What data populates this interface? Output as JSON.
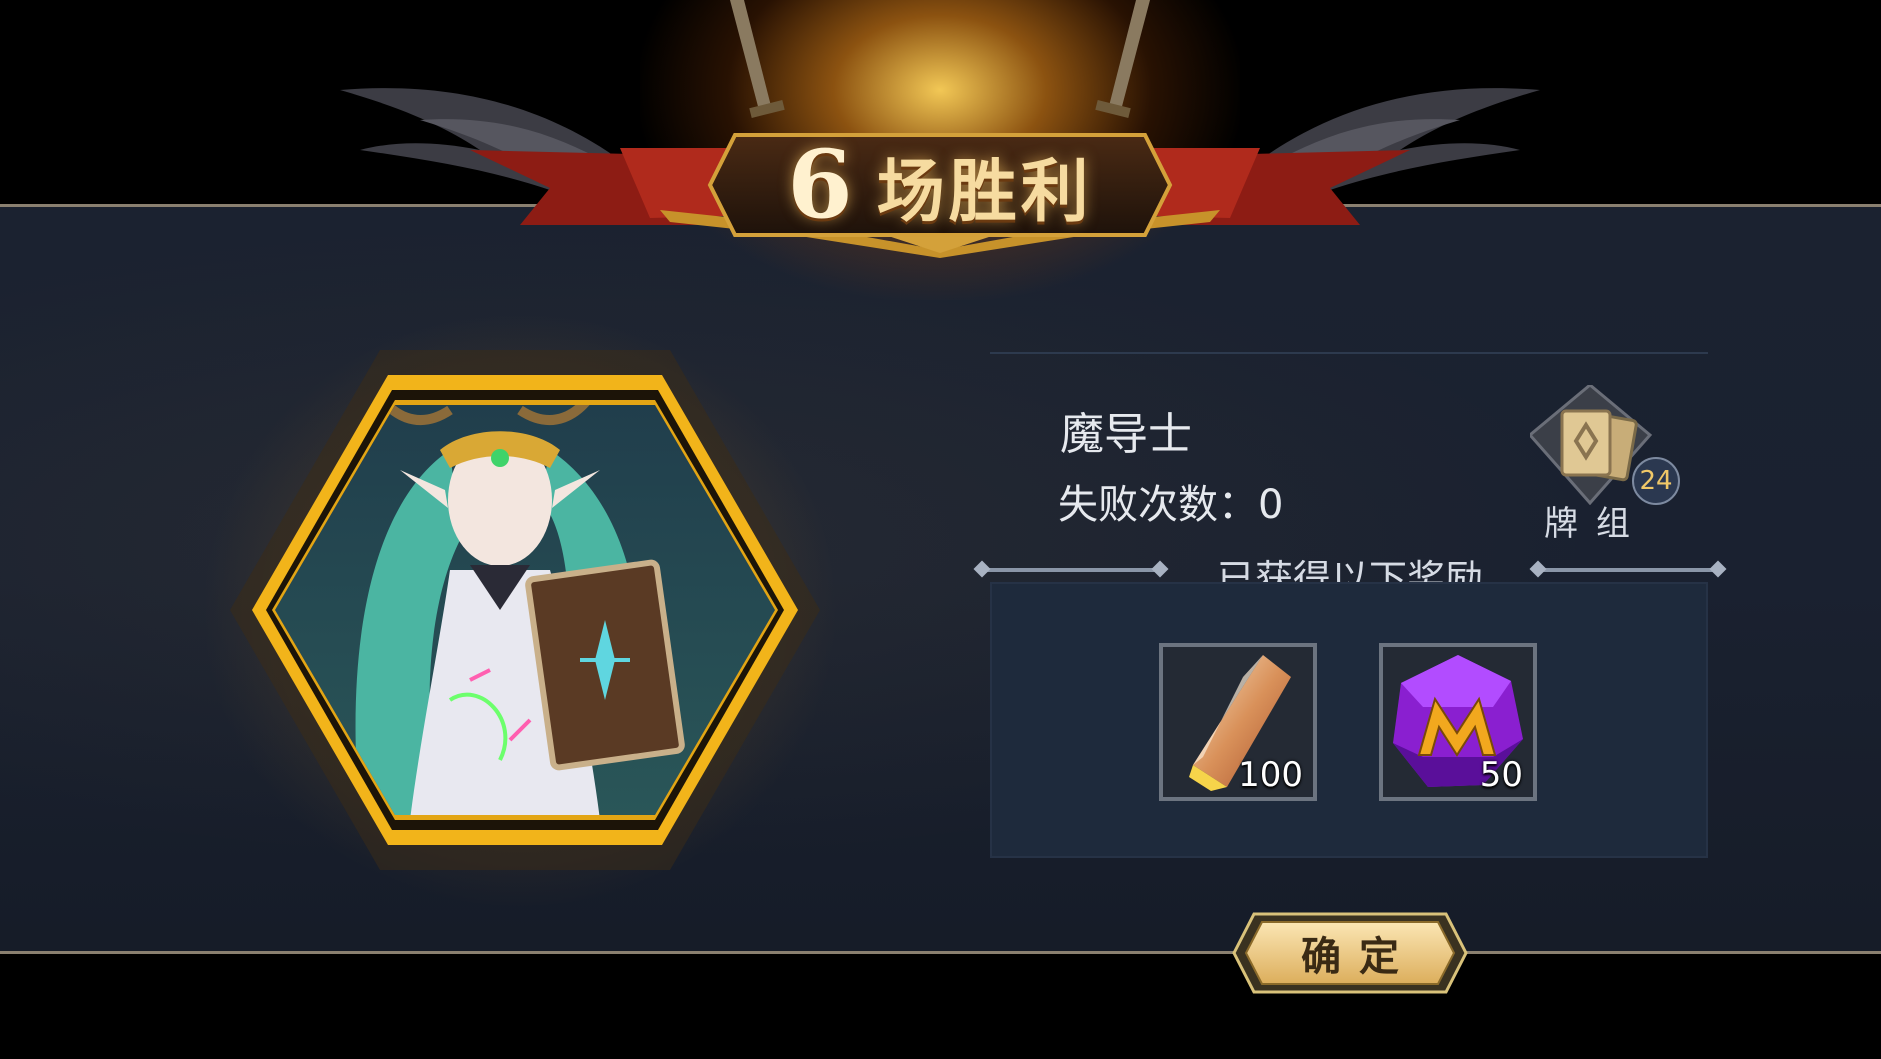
{
  "header": {
    "win_count": "6",
    "win_label": "场胜利"
  },
  "hero": {
    "portrait_icon": "mage-portrait-icon",
    "class_name": "魔导士",
    "defeats_label": "失败次数：",
    "defeats_value": "0"
  },
  "deck": {
    "icon": "card-deck-icon",
    "count": "24",
    "label": "牌组"
  },
  "rewards": {
    "title": "已获得以下奖励",
    "items": [
      {
        "icon": "amber-crystal-icon",
        "quantity": "100"
      },
      {
        "icon": "purple-m-gem-icon",
        "quantity": "50"
      }
    ]
  },
  "confirm": {
    "label": "确定"
  },
  "colors": {
    "gold": "#f2b41a",
    "panel": "#1b2230",
    "title_text": "#f6dba0",
    "button": "#f0cf8a"
  }
}
